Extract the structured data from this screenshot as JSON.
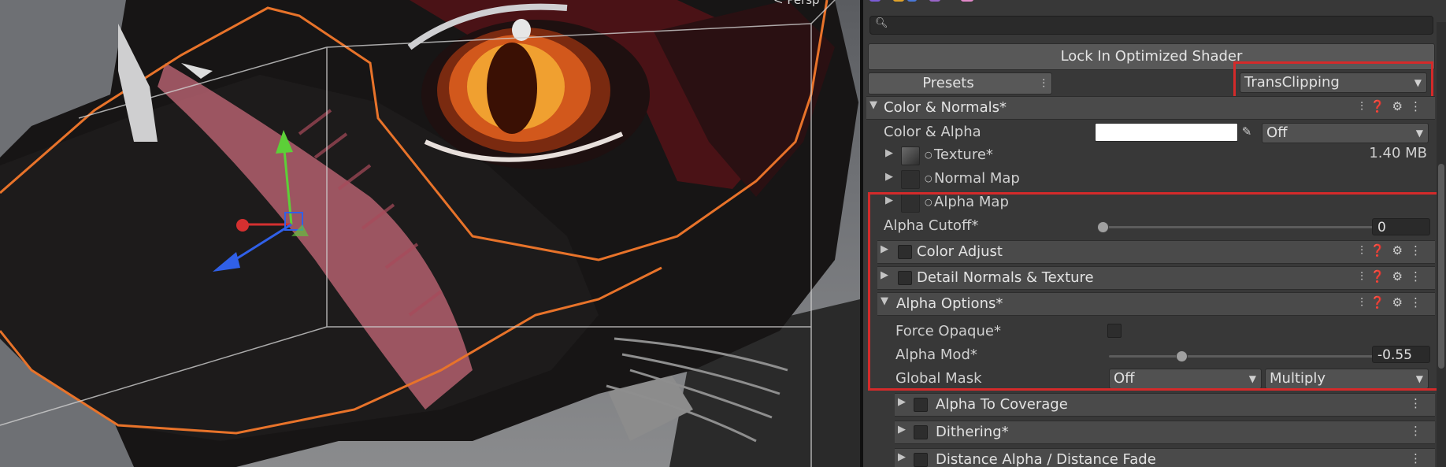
{
  "scene": {
    "view_label": "< Persp"
  },
  "inspector": {
    "search_placeholder": "",
    "lock_button": "Lock In Optimized Shader",
    "presets_button": "Presets",
    "preset_dropdown": "TransClipping",
    "color_normals": {
      "title": "Color & Normals*",
      "color_alpha_label": "Color & Alpha",
      "color_alpha_value": "#ffffff",
      "color_alpha_dropdown": "Off",
      "texture_label": "Texture*",
      "texture_size": "1.40 MB",
      "normal_map_label": "Normal Map",
      "alpha_map_label": "Alpha Map",
      "alpha_cutoff_label": "Alpha Cutoff*",
      "alpha_cutoff_value": "0"
    },
    "color_adjust": {
      "title": "Color Adjust"
    },
    "detail_normals": {
      "title": "Detail Normals & Texture"
    },
    "alpha_options": {
      "title": "Alpha Options*",
      "force_opaque_label": "Force Opaque*",
      "alpha_mod_label": "Alpha Mod*",
      "alpha_mod_value": "-0.55",
      "alpha_mod_fraction": 0.25,
      "global_mask_label": "Global Mask",
      "global_mask_dropdown": "Off",
      "global_mask_blend": "Multiply"
    },
    "alpha_to_coverage": {
      "title": "Alpha To Coverage"
    },
    "dithering": {
      "title": "Dithering*"
    },
    "distance_alpha": {
      "title": "Distance Alpha / Distance Fade"
    }
  },
  "colors": {
    "highlight": "#d42a2a",
    "panel_bg": "#383838",
    "header_bg": "#4a4a4a",
    "selection_outline": "#e8732a"
  }
}
